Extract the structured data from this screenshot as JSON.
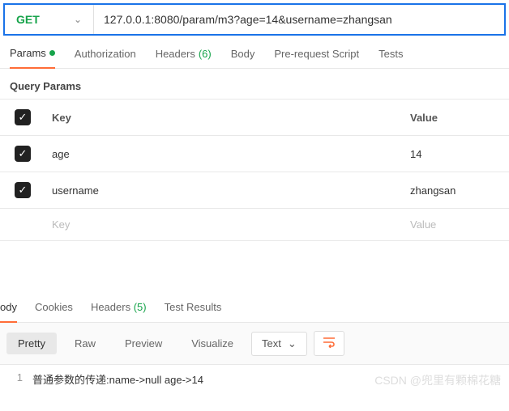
{
  "request": {
    "method": "GET",
    "url": "127.0.0.1:8080/param/m3?age=14&username=zhangsan"
  },
  "req_tabs": {
    "params": "Params",
    "authorization": "Authorization",
    "headers": "Headers",
    "headers_count": "(6)",
    "body": "Body",
    "prerequest": "Pre-request Script",
    "tests": "Tests"
  },
  "section_title": "Query Params",
  "table": {
    "key_header": "Key",
    "value_header": "Value",
    "rows": [
      {
        "key": "age",
        "value": "14"
      },
      {
        "key": "username",
        "value": "zhangsan"
      }
    ],
    "placeholder_key": "Key",
    "placeholder_value": "Value"
  },
  "resp_tabs": {
    "body": "ody",
    "cookies": "Cookies",
    "headers": "Headers",
    "headers_count": "(5)",
    "test_results": "Test Results"
  },
  "views": {
    "pretty": "Pretty",
    "raw": "Raw",
    "preview": "Preview",
    "visualize": "Visualize",
    "type": "Text"
  },
  "response": {
    "line_no": "1",
    "content": "普通参数的传递:name->null age->14"
  },
  "watermark": "CSDN @兜里有颗棉花糖"
}
